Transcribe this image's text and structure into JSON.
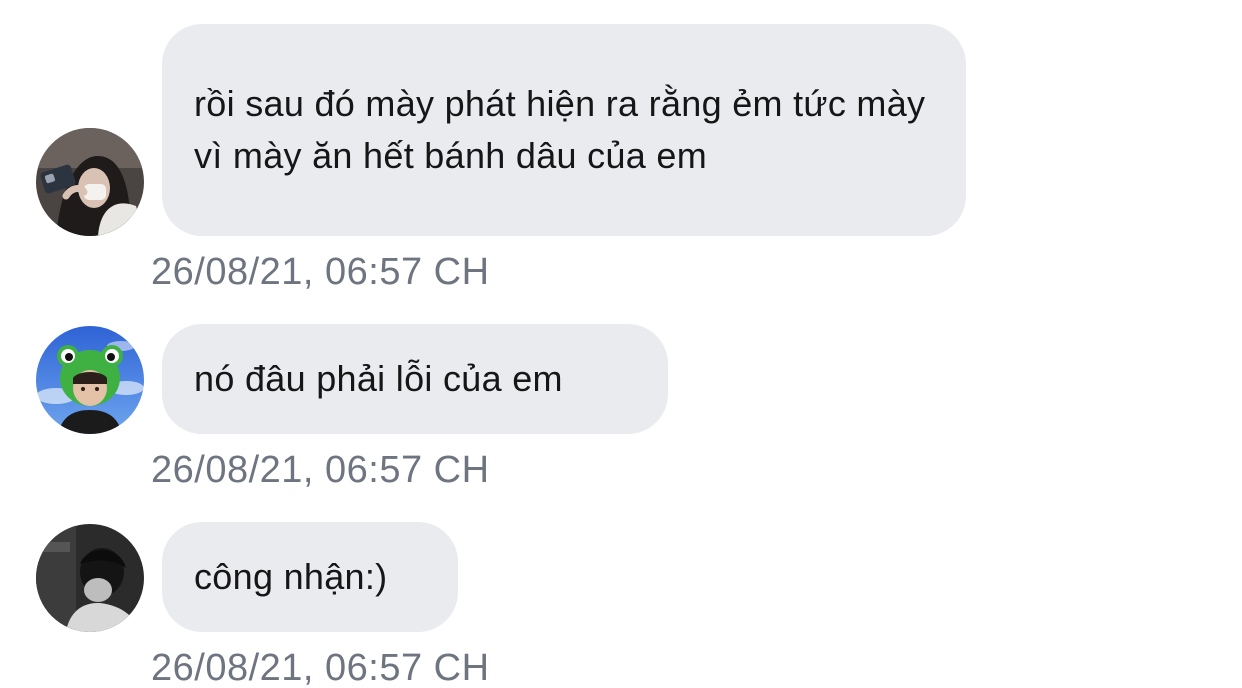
{
  "colors": {
    "bubble_background": "#e9ebef",
    "message_text": "#161616",
    "timestamp_text": "#6e7480"
  },
  "messages": [
    {
      "avatar_icon": "avatar-girl-with-phone-icon",
      "text": "rồi sau đó mày phát hiện ra rằng ẻm tức mày vì mày ăn hết bánh dâu của em",
      "timestamp": "26/08/21, 06:57 CH"
    },
    {
      "avatar_icon": "avatar-frog-hat-icon",
      "text": "nó đâu phải lỗi của em",
      "timestamp": "26/08/21, 06:57 CH"
    },
    {
      "avatar_icon": "avatar-monochrome-person-icon",
      "text": "công nhận:)",
      "timestamp": "26/08/21, 06:57 CH"
    }
  ]
}
